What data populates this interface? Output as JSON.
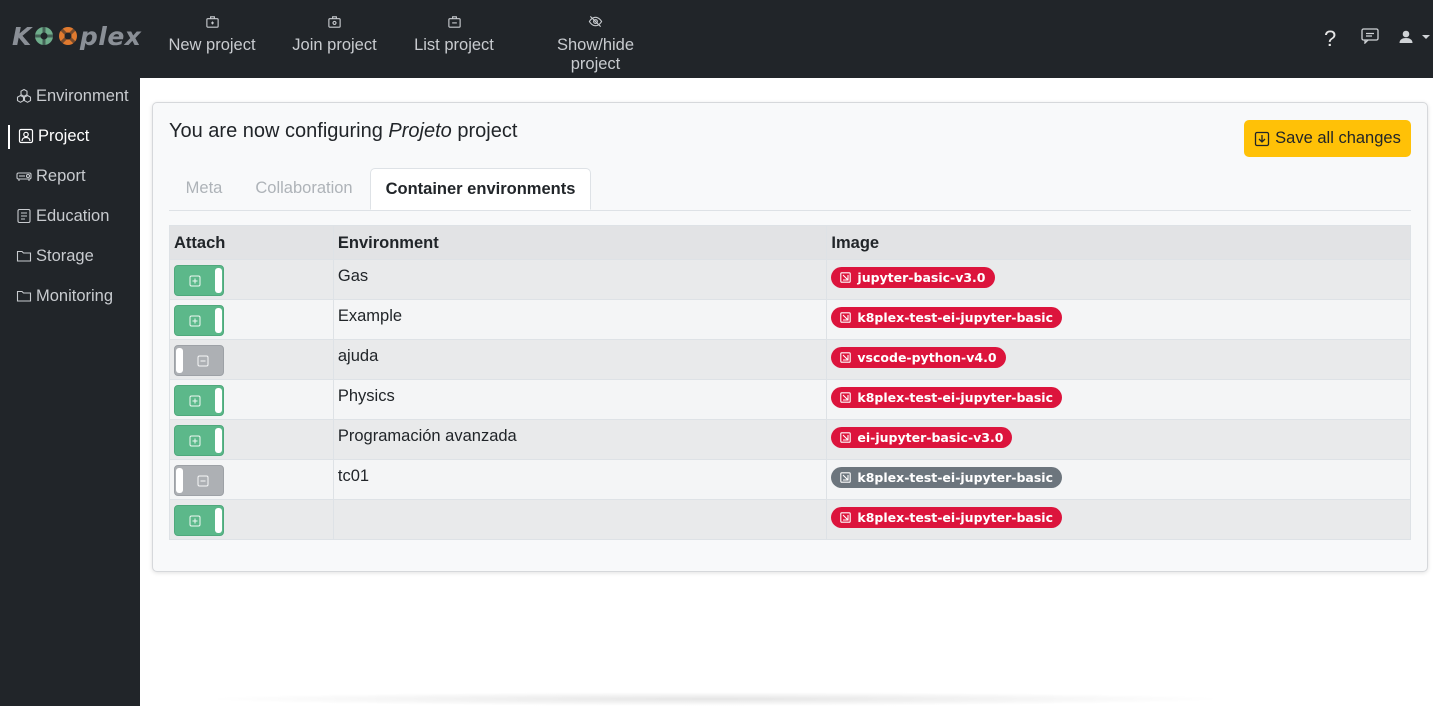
{
  "app": {
    "logo_text_1": "K",
    "logo_text_2": "plex"
  },
  "topnav": [
    {
      "label": "New project",
      "icon": "briefcase-plus-icon"
    },
    {
      "label": "Join project",
      "icon": "briefcase-join-icon"
    },
    {
      "label": "List project",
      "icon": "briefcase-list-icon"
    },
    {
      "label": "Show/hide project",
      "icon": "eye-slash-icon"
    }
  ],
  "topright": {
    "help_label": "?",
    "chat_icon": "chat-icon",
    "user_icon": "user-icon"
  },
  "sidebar": {
    "items": [
      {
        "label": "Environment",
        "icon": "boxes-icon"
      },
      {
        "label": "Project",
        "icon": "person-square-icon",
        "active": true
      },
      {
        "label": "Report",
        "icon": "projector-icon"
      },
      {
        "label": "Education",
        "icon": "education-icon"
      },
      {
        "label": "Storage",
        "icon": "folder-icon"
      },
      {
        "label": "Monitoring",
        "icon": "folder-icon"
      }
    ]
  },
  "card": {
    "title_prefix": "You are now configuring ",
    "project_name": "Projeto",
    "title_suffix": " project",
    "save_label": "Save all changes"
  },
  "tabs": [
    {
      "label": "Meta",
      "active": false
    },
    {
      "label": "Collaboration",
      "active": false
    },
    {
      "label": "Container environments",
      "active": true
    }
  ],
  "table": {
    "headers": [
      "Attach",
      "Environment",
      "Image"
    ],
    "rows": [
      {
        "attached": true,
        "environment": "Gas",
        "image": "jupyter-basic-v3.0",
        "image_color": "#dc143c"
      },
      {
        "attached": true,
        "environment": "Example",
        "image": "k8plex-test-ei-jupyter-basic",
        "image_color": "#dc143c"
      },
      {
        "attached": false,
        "environment": "ajuda",
        "image": "vscode-python-v4.0",
        "image_color": "#dc143c"
      },
      {
        "attached": true,
        "environment": "Physics",
        "image": "k8plex-test-ei-jupyter-basic",
        "image_color": "#dc143c"
      },
      {
        "attached": true,
        "environment": "Programación avanzada",
        "image": "ei-jupyter-basic-v3.0",
        "image_color": "#dc143c"
      },
      {
        "attached": false,
        "environment": "tc01",
        "image": "k8plex-test-ei-jupyter-basic",
        "image_color": "#6c757d"
      },
      {
        "attached": true,
        "environment": "",
        "image": "k8plex-test-ei-jupyter-basic",
        "image_color": "#dc143c"
      }
    ]
  },
  "colors": {
    "topbar": "#212529",
    "save_button": "#ffc107",
    "toggle_on": "#5cb88a",
    "toggle_off": "#adb0b4",
    "badge_active": "#dc143c",
    "badge_inactive": "#6c757d"
  }
}
